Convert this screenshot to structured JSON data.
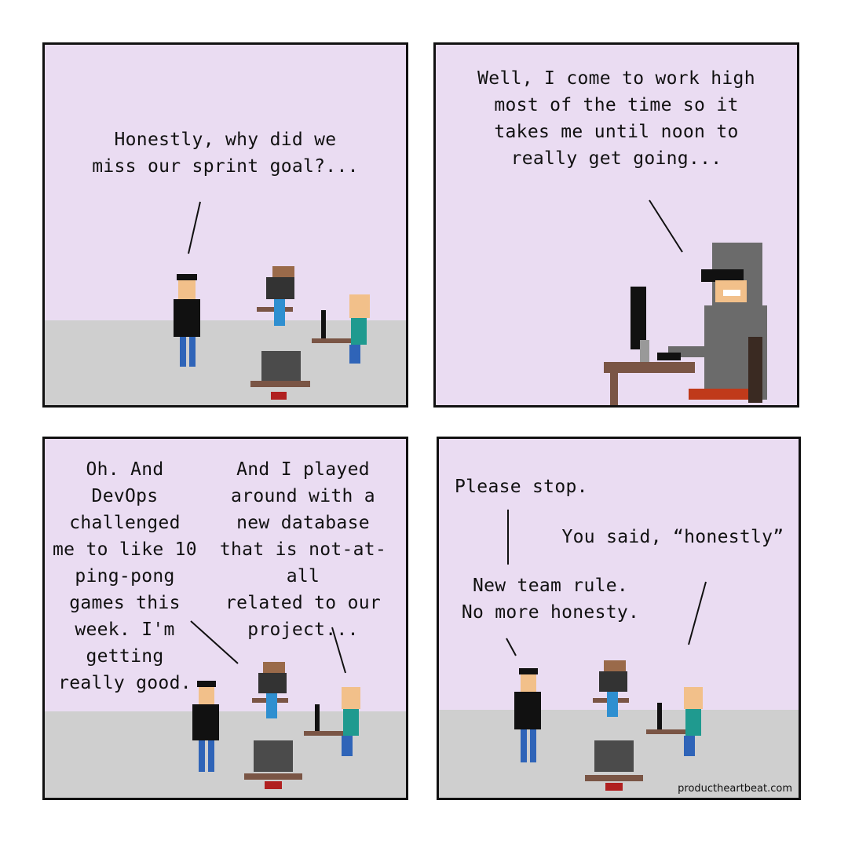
{
  "panels": [
    {
      "id": "panel-1",
      "captions": {
        "manager": "Honestly, why did we\nmiss our sprint goal?..."
      }
    },
    {
      "id": "panel-2",
      "captions": {
        "dev_sunglasses": "Well, I come to work high\nmost of the time so it\ntakes me until noon to\nreally get going..."
      }
    },
    {
      "id": "panel-3",
      "captions": {
        "dev_ponytail": "Oh. And\nDevOps\nchallenged\nme to like 10\nping-pong\ngames this\nweek. I'm\ngetting\nreally good.",
        "dev_glasses": "And I played\naround with a\nnew database\nthat is not-at-all\nrelated to our\nproject..."
      }
    },
    {
      "id": "panel-4",
      "captions": {
        "dev_ponytail": "Please stop.",
        "dev_glasses": "You said, “honestly”",
        "manager": "New team rule.\nNo more honesty."
      },
      "credit": "productheartbeat.com"
    }
  ],
  "colors": {
    "panel_bg": "#eadcf2",
    "floor": "#cfcfcf",
    "outline": "#111111",
    "desk": "#7a5545",
    "shirt_teal": "#1f9a8f",
    "jeans": "#2f64b8",
    "hoodie_gray": "#6b6b6b"
  }
}
